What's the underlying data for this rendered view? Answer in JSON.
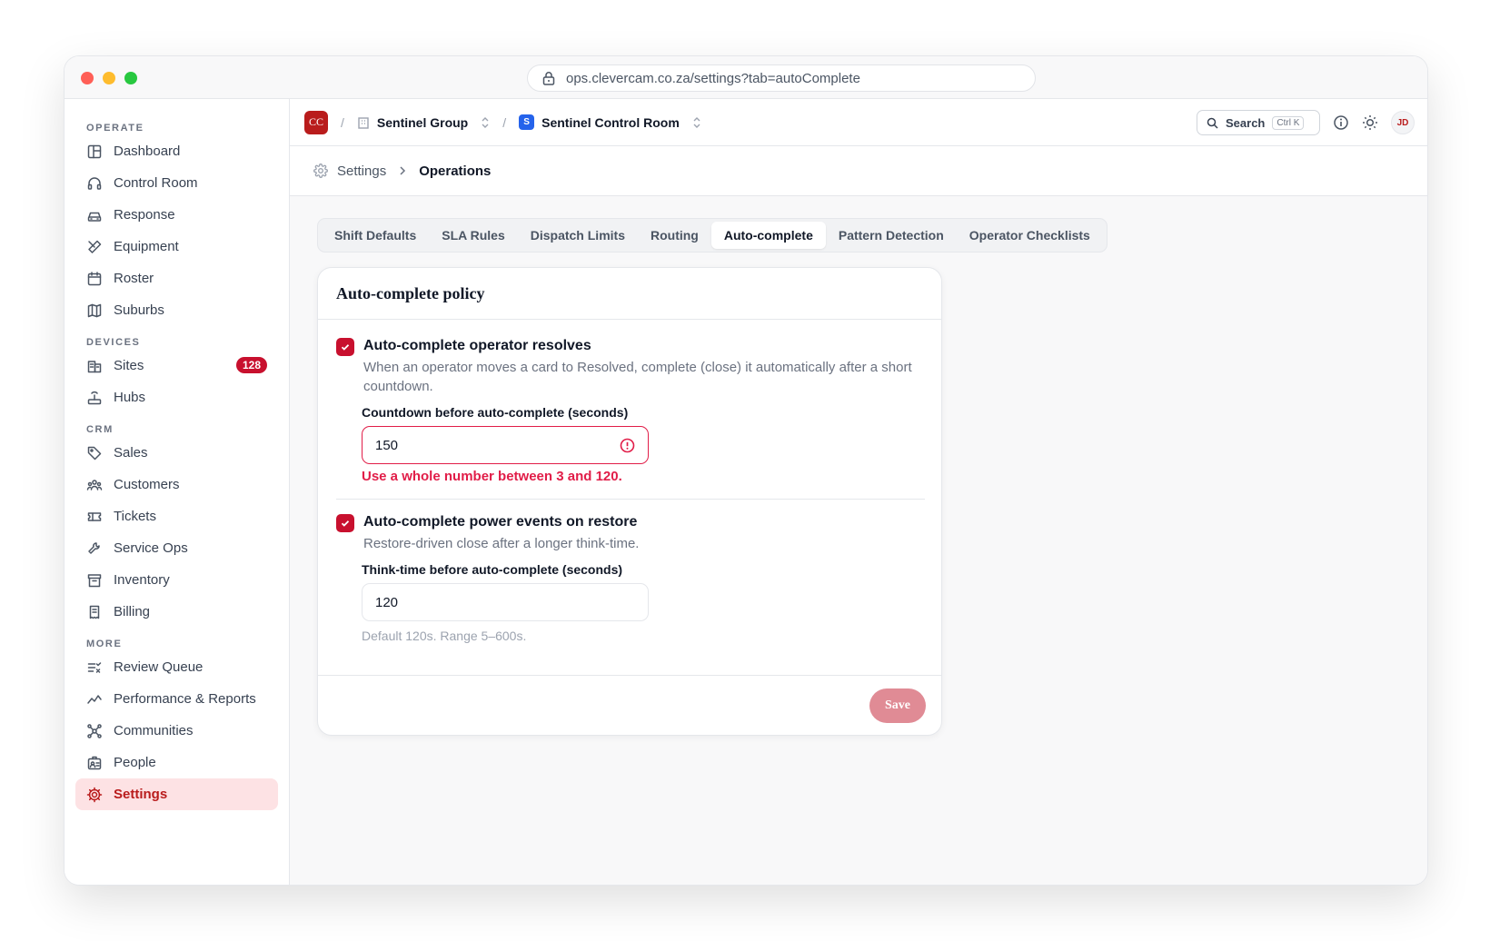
{
  "browser": {
    "url": "ops.clevercam.co.za/settings?tab=autoComplete"
  },
  "sidebar": {
    "sections": [
      {
        "title": "OPERATE",
        "items": [
          {
            "label": "Dashboard",
            "icon": "dashboard-icon"
          },
          {
            "label": "Control Room",
            "icon": "headset-icon"
          },
          {
            "label": "Response",
            "icon": "car-icon"
          },
          {
            "label": "Equipment",
            "icon": "tools-icon"
          },
          {
            "label": "Roster",
            "icon": "calendar-icon"
          },
          {
            "label": "Suburbs",
            "icon": "map-icon"
          }
        ]
      },
      {
        "title": "DEVICES",
        "items": [
          {
            "label": "Sites",
            "icon": "building-icon",
            "badge": "128"
          },
          {
            "label": "Hubs",
            "icon": "router-icon"
          }
        ]
      },
      {
        "title": "CRM",
        "items": [
          {
            "label": "Sales",
            "icon": "tag-icon"
          },
          {
            "label": "Customers",
            "icon": "users-icon"
          },
          {
            "label": "Tickets",
            "icon": "ticket-icon"
          },
          {
            "label": "Service Ops",
            "icon": "wrench-icon"
          },
          {
            "label": "Inventory",
            "icon": "archive-icon"
          },
          {
            "label": "Billing",
            "icon": "receipt-icon"
          }
        ]
      },
      {
        "title": "MORE",
        "items": [
          {
            "label": "Review Queue",
            "icon": "list-check-icon"
          },
          {
            "label": "Performance & Reports",
            "icon": "trend-icon"
          },
          {
            "label": "Communities",
            "icon": "network-icon"
          },
          {
            "label": "People",
            "icon": "id-badge-icon"
          },
          {
            "label": "Settings",
            "icon": "gear-icon",
            "active": true
          }
        ]
      }
    ]
  },
  "topbar": {
    "logo": "CC",
    "org": "Sentinel Group",
    "room_badge": "S",
    "room": "Sentinel Control Room",
    "search_label": "Search",
    "search_kbd": "Ctrl K",
    "avatar": "JD"
  },
  "breadcrumb": {
    "parent": "Settings",
    "current": "Operations"
  },
  "tabs": [
    "Shift Defaults",
    "SLA Rules",
    "Dispatch Limits",
    "Routing",
    "Auto-complete",
    "Pattern Detection",
    "Operator Checklists"
  ],
  "active_tab": "Auto-complete",
  "card": {
    "title": "Auto-complete policy",
    "option1": {
      "label": "Auto-complete operator resolves",
      "checked": true,
      "description": "When an operator moves a card to Resolved, complete (close) it automatically after a short countdown.",
      "field_label": "Countdown before auto-complete (seconds)",
      "value": "150",
      "error": "Use a whole number between 3 and 120."
    },
    "option2": {
      "label": "Auto-complete power events on restore",
      "checked": true,
      "description": "Restore-driven close after a longer think-time.",
      "field_label": "Think-time before auto-complete (seconds)",
      "value": "120",
      "hint": "Default 120s. Range 5–600s."
    },
    "save_label": "Save"
  },
  "colors": {
    "accent": "#c8102e",
    "error": "#e11d48",
    "save_disabled": "#e08b95"
  }
}
